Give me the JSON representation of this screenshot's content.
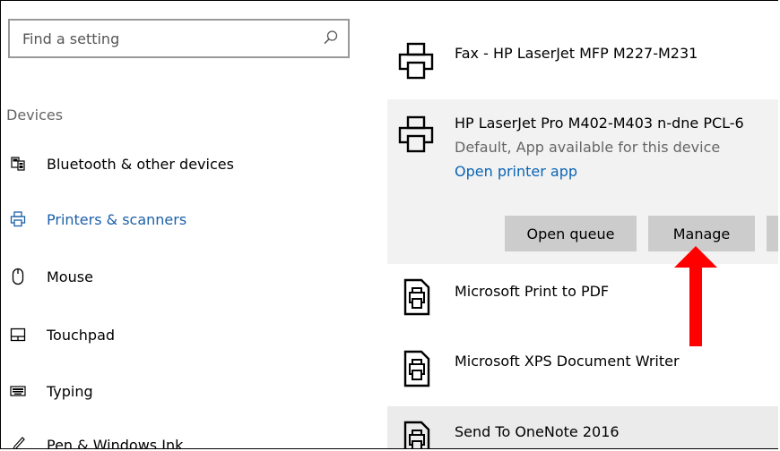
{
  "search": {
    "placeholder": "Find a setting"
  },
  "sidebar": {
    "heading": "Devices",
    "items": [
      {
        "label": "Bluetooth & other devices",
        "icon": "bluetooth-devices-icon"
      },
      {
        "label": "Printers & scanners",
        "icon": "printer-icon",
        "active": true
      },
      {
        "label": "Mouse",
        "icon": "mouse-icon"
      },
      {
        "label": "Touchpad",
        "icon": "touchpad-icon"
      },
      {
        "label": "Typing",
        "icon": "keyboard-icon"
      },
      {
        "label": "Pen & Windows Ink",
        "icon": "pen-icon"
      }
    ]
  },
  "printers": [
    {
      "name": "Fax - HP LaserJet MFP M227-M231",
      "icon": "printer-icon"
    },
    {
      "name": "HP LaserJet Pro M402-M403 n-dne PCL-6",
      "status": "Default, App available for this device",
      "link": "Open printer app",
      "icon": "printer-icon",
      "buttons": {
        "open_queue": "Open queue",
        "manage": "Manage"
      }
    },
    {
      "name": "Microsoft Print to PDF",
      "icon": "document-printer-icon"
    },
    {
      "name": "Microsoft XPS Document Writer",
      "icon": "document-printer-icon"
    },
    {
      "name": "Send To OneNote 2016",
      "icon": "document-printer-icon"
    }
  ],
  "colors": {
    "accent": "#1d5fa8",
    "link": "#0a64b4",
    "selected_bg": "#f2f2f2",
    "button_bg": "#cccccc",
    "annotation_arrow": "#ff0000"
  }
}
